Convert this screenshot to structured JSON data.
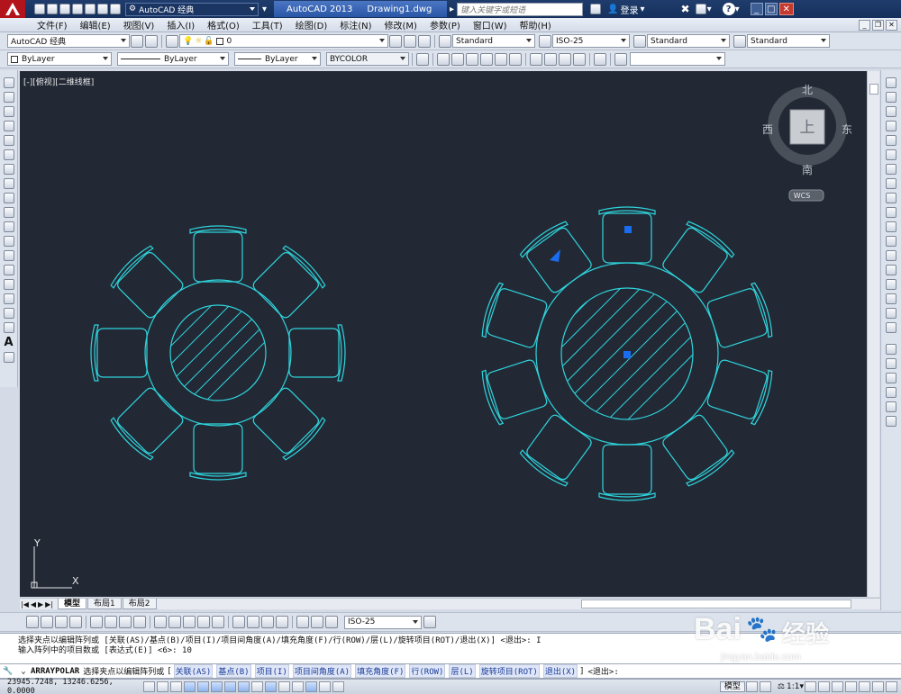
{
  "titlebar": {
    "workspace": "AutoCAD 经典",
    "app_name": "AutoCAD 2013",
    "doc_name": "Drawing1.dwg",
    "search_placeholder": "键入关键字或短语",
    "login": "登录",
    "help": "?"
  },
  "menu": [
    "文件(F)",
    "编辑(E)",
    "视图(V)",
    "插入(I)",
    "格式(O)",
    "工具(T)",
    "绘图(D)",
    "标注(N)",
    "修改(M)",
    "参数(P)",
    "窗口(W)",
    "帮助(H)"
  ],
  "toolbar1": {
    "workspace_combo": "AutoCAD 经典",
    "layer_combo": "0",
    "text_style": "Standard",
    "dim_style": "ISO-25",
    "table_style": "Standard",
    "mleader_style": "Standard"
  },
  "toolbar2": {
    "color": "ByLayer",
    "linetype": "ByLayer",
    "lineweight": "ByLayer",
    "plotstyle": "BYCOLOR"
  },
  "viewport": {
    "view_label": "[-][俯视][二维线框]",
    "viewcube": {
      "north": "北",
      "south": "南",
      "east": "东",
      "west": "西",
      "face": "上",
      "wcs": "WCS"
    },
    "ucs": {
      "x": "X",
      "y": "Y"
    },
    "grip_color": "#1a6cf0",
    "line_color": "#2fd4dc",
    "background": "#222935"
  },
  "layout_tabs": [
    "模型",
    "布局1",
    "布局2"
  ],
  "dim_toolbar": {
    "dim_style": "ISO-25"
  },
  "command_history": [
    "选择夹点以编辑阵列或 [关联(AS)/基点(B)/项目(I)/项目间角度(A)/填充角度(F)/行(ROW)/层(L)/旋转项目(ROT)/退出(X)] <退出>: I",
    "输入阵列中的项目数或 [表达式(E)] <6>: 10"
  ],
  "command_line": {
    "command": "ARRAYPOLAR",
    "prompt": "选择夹点以编辑阵列或",
    "options": [
      "关联(AS)",
      "基点(B)",
      "项目(I)",
      "项目间角度(A)",
      "填充角度(F)",
      "行(ROW)",
      "层(L)",
      "旋转项目(ROT)",
      "退出(X)"
    ],
    "suffix": "<退出>:"
  },
  "statusbar": {
    "coords": "23945.7248, 13246.6256, 0.0000",
    "model": "模型",
    "scale": "1:1"
  },
  "watermark": {
    "brand": "Bai",
    "brand2": "经验",
    "url": "jingyan.baidu.com"
  }
}
